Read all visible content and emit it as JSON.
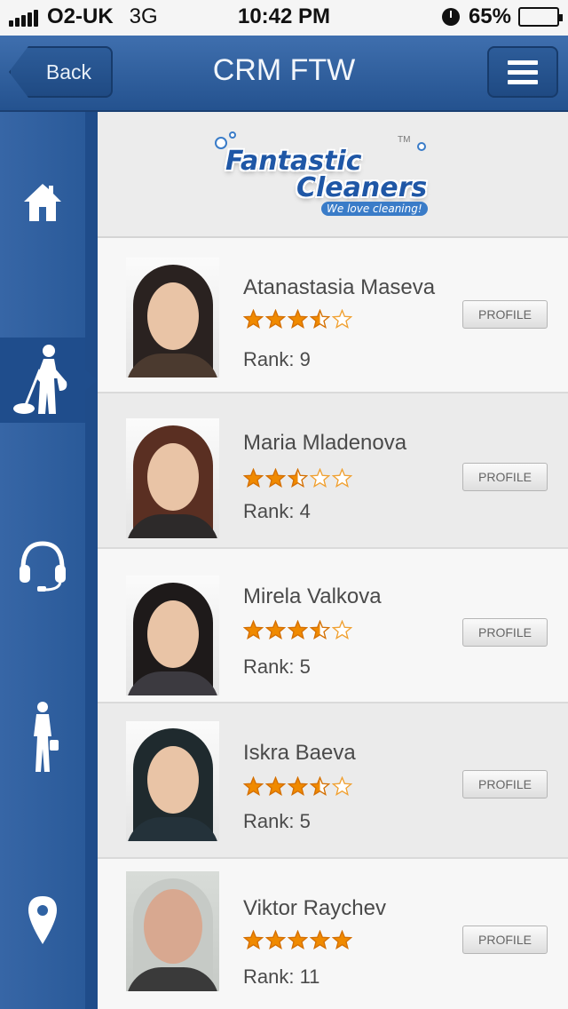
{
  "status_bar": {
    "carrier": "O2-UK",
    "network": "3G",
    "time": "10:42 PM",
    "battery": "65%",
    "battery_level": 0.65
  },
  "nav": {
    "back_label": "Back",
    "title": "CRM FTW"
  },
  "sidebar": {
    "items": [
      {
        "icon": "home-icon",
        "active": false
      },
      {
        "icon": "cleaner-icon",
        "active": true
      },
      {
        "icon": "headset-icon",
        "active": false
      },
      {
        "icon": "businesswoman-icon",
        "active": false
      },
      {
        "icon": "map-pin-icon",
        "active": false
      }
    ]
  },
  "logo": {
    "line1": "Fantastic",
    "line2": "Cleaners",
    "tagline": "We love cleaning!",
    "trademark": "TM"
  },
  "cleaners": [
    {
      "name": "Atanastasia Maseva",
      "rating": 3.5,
      "rank_text": "Rank: 9",
      "button": "PROFILE"
    },
    {
      "name": "Maria Mladenova",
      "rating": 2.5,
      "rank_text": "Rank: 4",
      "button": "PROFILE"
    },
    {
      "name": "Mirela Valkova",
      "rating": 3.5,
      "rank_text": "Rank: 5",
      "button": "PROFILE"
    },
    {
      "name": "Iskra Baeva",
      "rating": 3.5,
      "rank_text": "Rank: 5",
      "button": "PROFILE"
    },
    {
      "name": "Viktor Raychev",
      "rating": 5,
      "rank_text": "Rank: 11",
      "button": "PROFILE"
    }
  ],
  "colors": {
    "nav_blue": "#2b5a97",
    "star_orange": "#f08a00",
    "star_empty_stroke": "#f0a030"
  }
}
